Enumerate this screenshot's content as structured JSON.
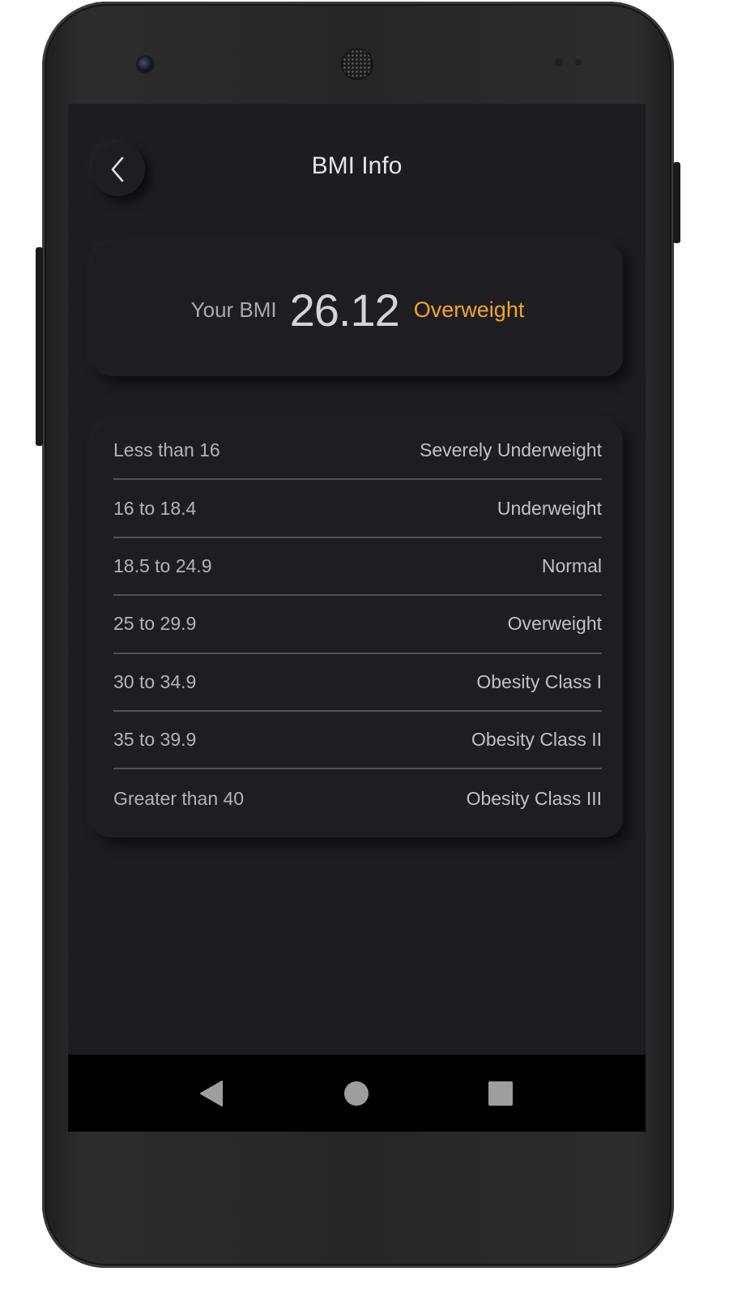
{
  "header": {
    "title": "BMI Info",
    "back_icon": "chevron-left-icon"
  },
  "bmi": {
    "label": "Your BMI",
    "value": "26.12",
    "status": "Overweight",
    "status_color": "#f5a716"
  },
  "ranges": [
    {
      "range": "Less than 16",
      "category": "Severely Underweight"
    },
    {
      "range": "16 to 18.4",
      "category": "Underweight"
    },
    {
      "range": "18.5 to 24.9",
      "category": "Normal"
    },
    {
      "range": "25 to 29.9",
      "category": "Overweight"
    },
    {
      "range": "30 to 34.9",
      "category": "Obesity Class I"
    },
    {
      "range": "35 to 39.9",
      "category": "Obesity Class II"
    },
    {
      "range": "Greater than 40",
      "category": "Obesity Class III"
    }
  ],
  "navbar": {
    "icons": [
      "back-triangle-icon",
      "home-circle-icon",
      "recents-square-icon"
    ]
  },
  "colors": {
    "background": "#1c1c21",
    "accent": "#f5a716"
  }
}
